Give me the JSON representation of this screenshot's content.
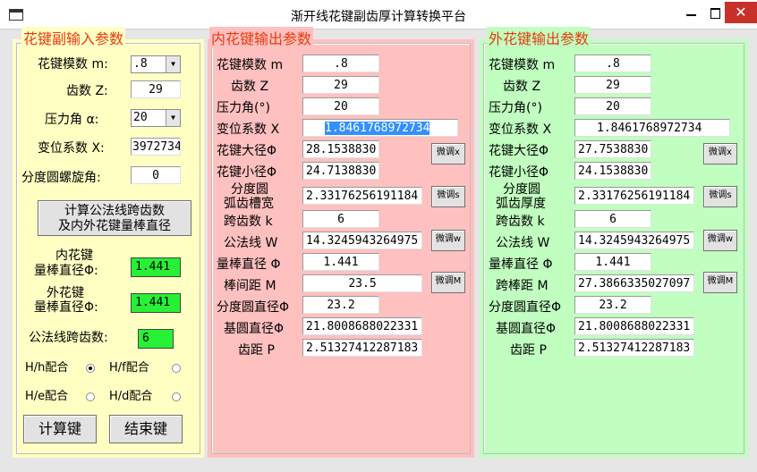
{
  "window": {
    "title": "渐开线花键副齿厚计算转换平台",
    "close_glyph": "✕"
  },
  "left": {
    "legend": "花键副输入参数",
    "module_label": "花键模数 m:",
    "module_value": ".8",
    "teeth_label": "齿数 Z:",
    "teeth_value": "29",
    "pressure_label": "压力角 α:",
    "pressure_value": "20",
    "shift_label": "变位系数 X:",
    "shift_value": "3972734",
    "helix_label": "分度圆螺旋角:",
    "helix_value": "0",
    "calc_btn_line1": "计算公法线跨齿数",
    "calc_btn_line2": "及内外花键量棒直径",
    "inner_rod_line1": "内花键",
    "inner_rod_line2": "量棒直径Φ:",
    "inner_rod_value": "1.441",
    "outer_rod_line1": "外花键",
    "outer_rod_line2": "量棒直径Φ:",
    "outer_rod_value": "1.441",
    "span_label": "公法线跨齿数:",
    "span_value": "6",
    "radios": [
      {
        "label": "H/h配合",
        "checked": true
      },
      {
        "label": "H/f配合",
        "checked": false
      },
      {
        "label": "H/e配合",
        "checked": false
      },
      {
        "label": "H/d配合",
        "checked": false
      }
    ],
    "compute_btn": "计算键",
    "end_btn": "结束键"
  },
  "inner": {
    "legend": "内花键输出参数",
    "rows": {
      "module": {
        "label": "花键模数 m",
        "value": ".8"
      },
      "teeth": {
        "label": "齿数  Z",
        "value": "29"
      },
      "pressure": {
        "label": "压力角(°)",
        "value": "20"
      },
      "shift": {
        "label": "变位系数 X",
        "value": "1.8461768972734"
      },
      "major": {
        "label": "花键大径Φ",
        "value": "28.1538830"
      },
      "minor": {
        "label": "花键小径Φ",
        "value": "24.7138830"
      },
      "arc": {
        "label1": "分度圆",
        "label2": "弧齿槽宽",
        "value": "2.33176256191184"
      },
      "span": {
        "label": "跨齿数 k",
        "value": "6"
      },
      "wn": {
        "label": "公法线 W",
        "value": "14.3245943264975"
      },
      "rod": {
        "label": "量棒直径 Φ",
        "value": "1.441"
      },
      "rodspan": {
        "label": "棒间距 M",
        "value": "23.5"
      },
      "pitch": {
        "label": "分度圆直径Φ",
        "value": "23.2"
      },
      "base": {
        "label": "基圆直径Φ",
        "value": "21.8008688022331"
      },
      "p": {
        "label": "齿距 P",
        "value": "2.51327412287183"
      }
    },
    "fine_btns": [
      "微调x",
      "微调s",
      "微调w",
      "微调M"
    ]
  },
  "outer": {
    "legend": "外花键输出参数",
    "rows": {
      "module": {
        "label": "花键模数 m",
        "value": ".8"
      },
      "teeth": {
        "label": "齿数  Z",
        "value": "29"
      },
      "pressure": {
        "label": "压力角(°)",
        "value": "20"
      },
      "shift": {
        "label": "变位系数 X",
        "value": "1.8461768972734"
      },
      "major": {
        "label": "花键大径Φ",
        "value": "27.7538830"
      },
      "minor": {
        "label": "花键小径Φ",
        "value": "24.1538830"
      },
      "arc": {
        "label1": "分度圆",
        "label2": "弧齿厚度",
        "value": "2.33176256191184"
      },
      "span": {
        "label": "跨齿数 k",
        "value": "6"
      },
      "wn": {
        "label": "公法线 W",
        "value": "14.3245943264975"
      },
      "rod": {
        "label": "量棒直径 Φ",
        "value": "1.441"
      },
      "rodspan": {
        "label": "跨棒距 M",
        "value": "27.3866335027097"
      },
      "pitch": {
        "label": "分度圆直径Φ",
        "value": "23.2"
      },
      "base": {
        "label": "基圆直径Φ",
        "value": "21.8008688022331"
      },
      "p": {
        "label": "齿距 P",
        "value": "2.51327412287183"
      }
    },
    "fine_btns": [
      "微调x",
      "微调s",
      "微调w",
      "微调M"
    ]
  },
  "colors": {
    "left_bg": "#ffffc4",
    "inner_bg": "#ffc0c0",
    "outer_bg": "#c0ffc0",
    "legend": "#e83b0f",
    "green": "#27f035"
  }
}
